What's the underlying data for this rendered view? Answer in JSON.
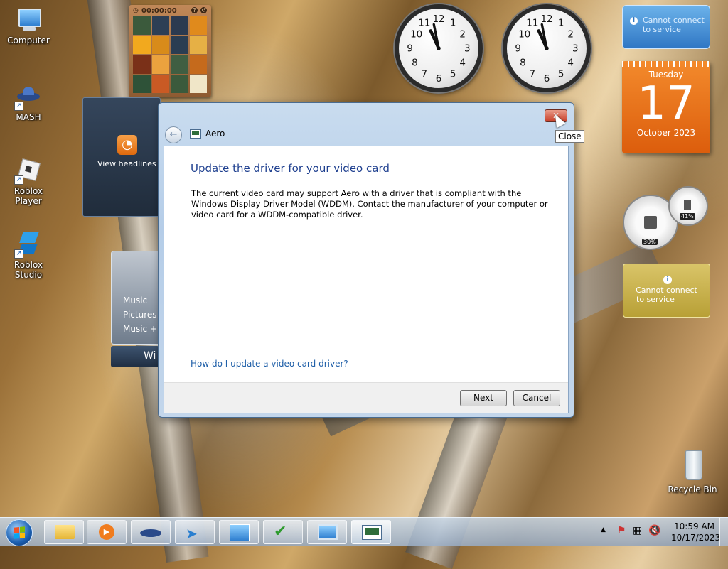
{
  "desktop": {
    "icons": [
      {
        "label": "Computer"
      },
      {
        "label": "MASH"
      },
      {
        "label": "Roblox Player"
      },
      {
        "label": "Roblox Studio"
      },
      {
        "label": "Recycle Bin"
      }
    ]
  },
  "gadgets": {
    "puzzle": {
      "timer": "00:00:00"
    },
    "feed_headlines": {
      "label": "View headlines"
    },
    "media": {
      "items": [
        "Music",
        "Pictures",
        "Music +"
      ],
      "footer": "Wi"
    },
    "weather_notice": {
      "line1": "Cannot connect",
      "line2": "to service"
    },
    "calendar": {
      "weekday": "Tuesday",
      "day": "17",
      "month_year": "October 2023"
    },
    "cpu_meter": {
      "cpu": "30%",
      "memory": "41%"
    },
    "currency_notice": {
      "line1": "Cannot connect",
      "line2": "to service"
    }
  },
  "window": {
    "title": "Aero",
    "heading": "Update the driver for your video card",
    "body": "The current video card may support Aero with a driver that is compliant with the Windows Display Driver Model (WDDM).  Contact the manufacturer of your computer or video card for a WDDM-compatible driver.",
    "help_link": "How do I update a video card driver?",
    "next_label": "Next",
    "cancel_label": "Cancel",
    "close_tooltip": "Close"
  },
  "taskbar": {
    "pinned": [
      "windows-explorer",
      "media-player",
      "mash",
      "messenger",
      "control-panel",
      "action-center",
      "remote-desktop",
      "aero-dialog"
    ],
    "clock_time": "10:59 AM",
    "clock_date": "10/17/2023"
  },
  "colors": {
    "heading_blue": "#1e3f8f",
    "link_blue": "#1f5fa8",
    "calendar_orange": "#e76a14",
    "close_red": "#c8402a"
  }
}
